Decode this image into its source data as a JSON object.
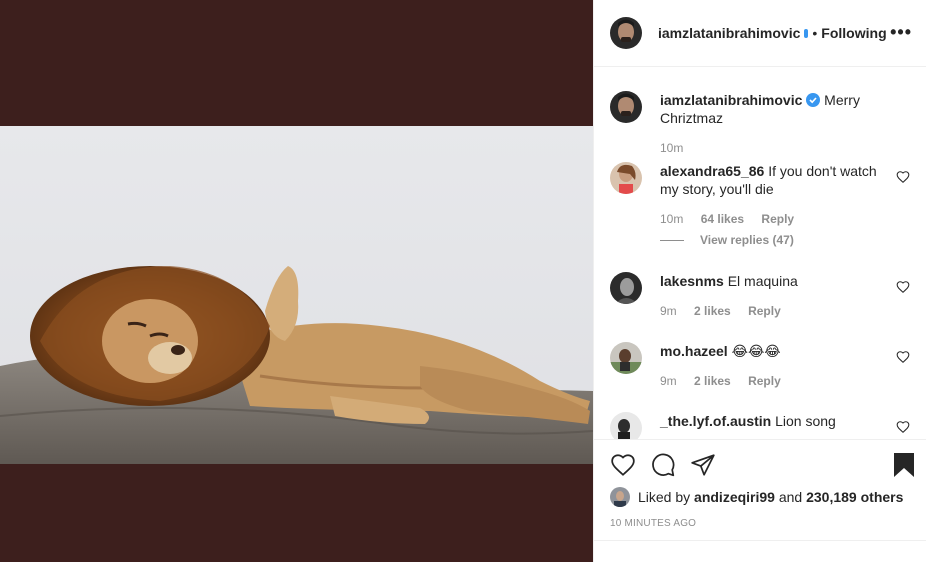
{
  "post": {
    "author": "iamzlatanibrahimovic",
    "separator": "•",
    "follow_status": "Following",
    "more_icon": "more-options-icon"
  },
  "caption": {
    "user": "iamzlatanibrahimovic",
    "text": "Merry Chriztmaz",
    "time": "10m",
    "verified_color": "#3897f0"
  },
  "comments": [
    {
      "user": "alexandra65_86",
      "text": "If you don't watch my story, you'll die",
      "time": "10m",
      "likes": "64 likes",
      "reply": "Reply",
      "view_replies": "View replies (47)"
    },
    {
      "user": "lakesnms",
      "text": "El maquina",
      "time": "9m",
      "likes": "2 likes",
      "reply": "Reply"
    },
    {
      "user": "mo.hazeel",
      "text": "😂😂😂",
      "time": "9m",
      "likes": "2 likes",
      "reply": "Reply"
    },
    {
      "user": "_the.lyf.of.austin",
      "text": "Lion song"
    }
  ],
  "likes": {
    "prefix": "Liked by",
    "user": "andizeqiri99",
    "conjunction": "and",
    "count": "230,189 others"
  },
  "timestamp": "10 MINUTES AGO",
  "colors": {
    "media_background": "#3d1f1d",
    "muted_text": "#8e8e8e",
    "accent_blue": "#3897f0"
  }
}
